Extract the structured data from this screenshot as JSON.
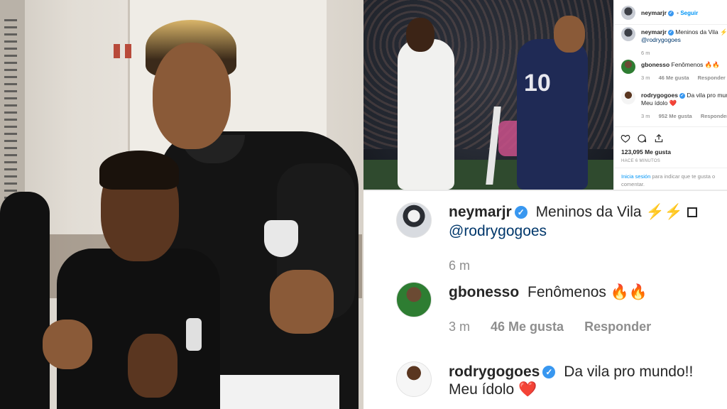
{
  "post": {
    "author": "neymarjr",
    "follow_label": "Seguir",
    "separator": "•",
    "caption_text": "Meninos da Vila",
    "caption_emoji": "⚡⚡",
    "caption_mention": "@rodrygogoes",
    "caption_age": "6 m",
    "likes_count": "123,095 Me gusta",
    "posted_ago": "HACE 6 MINUTOS",
    "login_link": "Inicia sesión",
    "login_prompt": "para indicar que te gusta o comentar."
  },
  "comments": [
    {
      "user": "gbonesso",
      "text": "Fenômenos",
      "emoji": "🔥🔥",
      "age": "3 m",
      "likes": "46 Me gusta",
      "reply_label": "Responder"
    },
    {
      "user": "rodrygogoes",
      "text": "Da vila pro mundo!!",
      "text_line2": "Meu ídolo",
      "emoji": "❤️",
      "age": "3 m",
      "likes": "952 Me gusta",
      "reply_label": "Responder"
    }
  ],
  "icons": {
    "like": "heart-icon",
    "comment": "comment-icon",
    "share": "share-icon",
    "verified": "verified-badge-icon"
  },
  "photo_right_top": {
    "jersey_number": "10"
  },
  "colors": {
    "link_blue": "#00376b",
    "follow_blue": "#0095f6",
    "verified_blue": "#3897f0",
    "meta_gray": "#8e8e8e"
  }
}
